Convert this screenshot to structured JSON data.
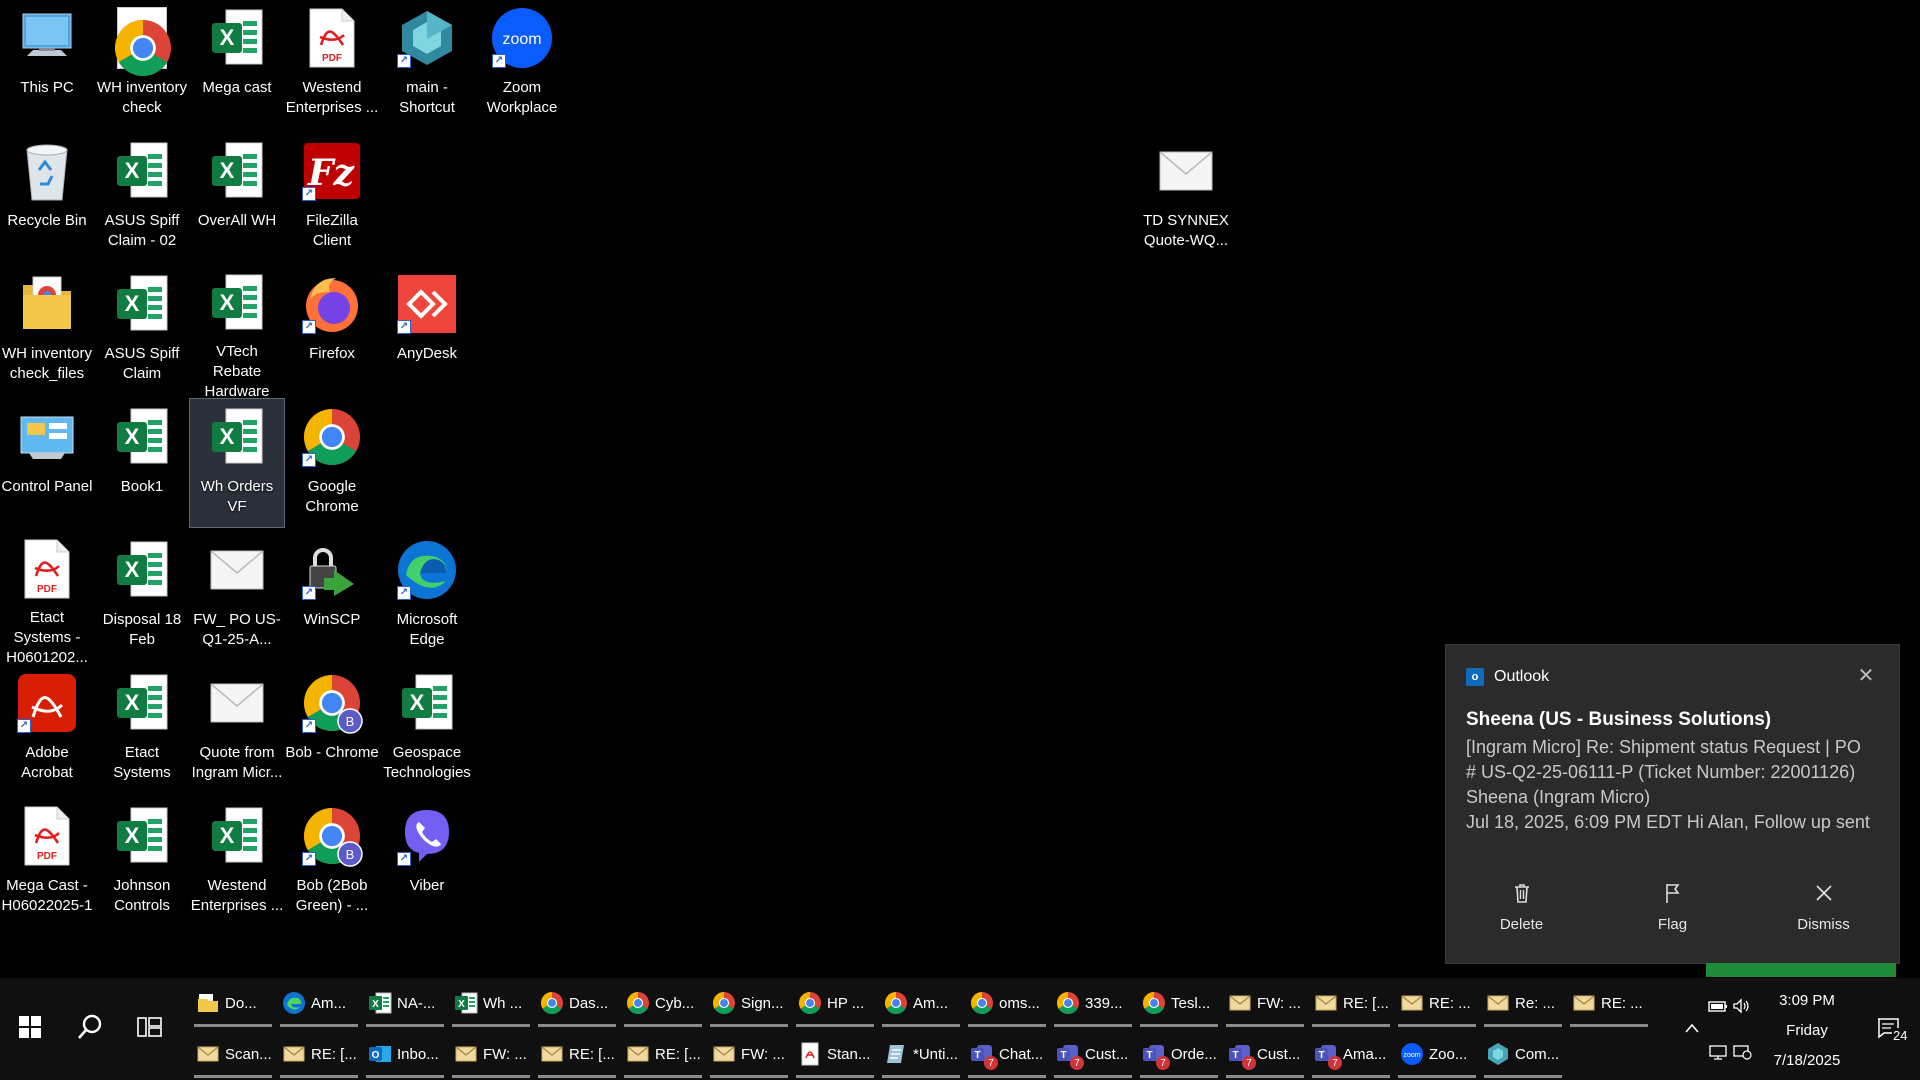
{
  "desktop": {
    "icons": [
      {
        "label": "This PC",
        "icon": "computer-icon"
      },
      {
        "label": "WH inventory check",
        "icon": "chrome-file-icon"
      },
      {
        "label": "Mega cast",
        "icon": "excel-icon"
      },
      {
        "label": "Westend Enterprises ...",
        "icon": "pdf-icon"
      },
      {
        "label": "main - Shortcut",
        "icon": "hexagon-app-icon"
      },
      {
        "label": "Zoom Workplace",
        "icon": "zoom-icon"
      },
      {
        "label": "Recycle Bin",
        "icon": "recycle-bin-icon"
      },
      {
        "label": "ASUS Spiff Claim - 02",
        "icon": "excel-icon"
      },
      {
        "label": "OverAll WH",
        "icon": "excel-icon"
      },
      {
        "label": "FileZilla Client",
        "icon": "filezilla-icon"
      },
      {
        "label": "WH inventory check_files",
        "icon": "folder-icon"
      },
      {
        "label": "ASUS Spiff Claim",
        "icon": "excel-icon"
      },
      {
        "label": "VTech Rebate Hardware",
        "icon": "excel-icon"
      },
      {
        "label": "Firefox",
        "icon": "firefox-icon"
      },
      {
        "label": "AnyDesk",
        "icon": "anydesk-icon"
      },
      {
        "label": "Control Panel",
        "icon": "control-panel-icon"
      },
      {
        "label": "Book1",
        "icon": "excel-icon"
      },
      {
        "label": "Wh Orders VF",
        "icon": "excel-icon"
      },
      {
        "label": "Google Chrome",
        "icon": "chrome-icon"
      },
      {
        "label": "Etact Systems - H0601202...",
        "icon": "pdf-icon"
      },
      {
        "label": "Disposal 18 Feb",
        "icon": "excel-icon"
      },
      {
        "label": "FW_ PO US-Q1-25-A...",
        "icon": "envelope-icon"
      },
      {
        "label": "WinSCP",
        "icon": "winscp-icon"
      },
      {
        "label": "Microsoft Edge",
        "icon": "edge-icon"
      },
      {
        "label": "Adobe Acrobat",
        "icon": "acrobat-icon"
      },
      {
        "label": "Etact Systems",
        "icon": "excel-icon"
      },
      {
        "label": "Quote from Ingram Micr...",
        "icon": "envelope-icon"
      },
      {
        "label": "Bob - Chrome",
        "icon": "chrome-profile-icon"
      },
      {
        "label": "Geospace Technologies",
        "icon": "excel-icon"
      },
      {
        "label": "Mega Cast - H06022025-1",
        "icon": "pdf-icon"
      },
      {
        "label": "Johnson Controls",
        "icon": "excel-icon"
      },
      {
        "label": "Westend Enterprises ...",
        "icon": "excel-icon"
      },
      {
        "label": "Bob (2Bob Green) - ...",
        "icon": "chrome-profile-icon"
      },
      {
        "label": "Viber",
        "icon": "viber-icon"
      },
      {
        "label": "TD SYNNEX Quote-WQ...",
        "icon": "envelope-icon"
      }
    ]
  },
  "toast": {
    "app": "Outlook",
    "sender": "Sheena (US - Business Solutions)",
    "lines": [
      "[Ingram Micro] Re: Shipment status Request | PO",
      "# US-Q2-25-06111-P (Ticket Number: 22001126)",
      "Sheena (Ingram Micro)",
      "Jul 18, 2025, 6:09 PM EDT   Hi Alan,  Follow up sent"
    ],
    "actions": {
      "delete": "Delete",
      "flag": "Flag",
      "dismiss": "Dismiss"
    },
    "close_glyph": "✕"
  },
  "taskbar": {
    "row1": [
      {
        "label": "Do...",
        "icon": "file-explorer-icon"
      },
      {
        "label": "Am...",
        "icon": "edge-icon"
      },
      {
        "label": "NA-...",
        "icon": "excel-icon"
      },
      {
        "label": "Wh ...",
        "icon": "excel-icon"
      },
      {
        "label": "Das...",
        "icon": "chrome-icon"
      },
      {
        "label": "Cyb...",
        "icon": "chrome-icon"
      },
      {
        "label": "Sign...",
        "icon": "chrome-icon"
      },
      {
        "label": "HP ...",
        "icon": "chrome-icon"
      },
      {
        "label": "Am...",
        "icon": "chrome-icon"
      },
      {
        "label": "oms...",
        "icon": "chrome-icon"
      },
      {
        "label": "339...",
        "icon": "chrome-icon"
      },
      {
        "label": "Tesl...",
        "icon": "chrome-icon"
      },
      {
        "label": "FW: ...",
        "icon": "envelope-icon"
      },
      {
        "label": "RE: [...",
        "icon": "envelope-icon"
      },
      {
        "label": "RE: ...",
        "icon": "envelope-icon"
      },
      {
        "label": "Re: ...",
        "icon": "envelope-icon"
      },
      {
        "label": "RE: ...",
        "icon": "envelope-icon"
      }
    ],
    "row2": [
      {
        "label": "Scan...",
        "icon": "envelope-icon"
      },
      {
        "label": "RE: [...",
        "icon": "envelope-icon"
      },
      {
        "label": "Inbo...",
        "icon": "outlook-icon"
      },
      {
        "label": "FW: ...",
        "icon": "envelope-icon"
      },
      {
        "label": "RE: [...",
        "icon": "envelope-icon"
      },
      {
        "label": "RE: [...",
        "icon": "envelope-icon"
      },
      {
        "label": "FW: ...",
        "icon": "envelope-icon"
      },
      {
        "label": "Stan...",
        "icon": "pdf-icon"
      },
      {
        "label": "*Unti...",
        "icon": "notepad-icon"
      },
      {
        "label": "Chat...",
        "icon": "teams-icon",
        "badge": "7"
      },
      {
        "label": "Cust...",
        "icon": "teams-icon",
        "badge": "7"
      },
      {
        "label": "Orde...",
        "icon": "teams-icon",
        "badge": "7"
      },
      {
        "label": "Cust...",
        "icon": "teams-icon",
        "badge": "7"
      },
      {
        "label": "Ama...",
        "icon": "teams-icon",
        "badge": "7"
      },
      {
        "label": "Zoo...",
        "icon": "zoom-icon"
      },
      {
        "label": "Com...",
        "icon": "hexagon-app-icon"
      }
    ],
    "clock": {
      "time": "3:09 PM",
      "day": "Friday",
      "date": "7/18/2025"
    },
    "notification_count": "24"
  }
}
